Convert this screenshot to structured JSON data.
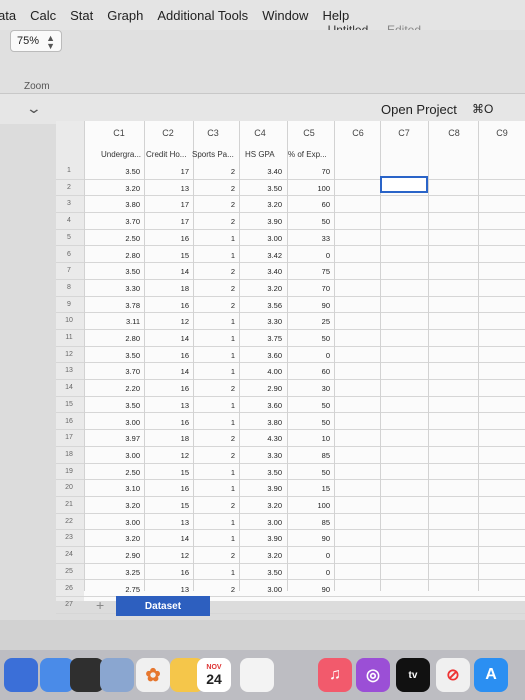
{
  "menubar": {
    "items": [
      "ata",
      "Calc",
      "Stat",
      "Graph",
      "Additional Tools",
      "Window",
      "Help"
    ]
  },
  "document": {
    "title": "Untitled",
    "sep": "—",
    "status": "Edited"
  },
  "zoom": {
    "value": "75%",
    "label": "Zoom"
  },
  "open_project": {
    "label": "Open Project",
    "shortcut": "⌘O"
  },
  "sheet": {
    "column_ids": [
      "C1",
      "C2",
      "C3",
      "C4",
      "C5",
      "C6",
      "C7",
      "C8",
      "C9"
    ],
    "variable_names": [
      "Undergra...",
      "Credit Ho...",
      "Sports Pa...",
      "HS GPA",
      "% of Exp..."
    ],
    "row_numbers": [
      "1",
      "2",
      "3",
      "4",
      "5",
      "6",
      "7",
      "8",
      "9",
      "10",
      "11",
      "12",
      "13",
      "14",
      "15",
      "16",
      "17",
      "18",
      "19",
      "20",
      "21",
      "22",
      "23",
      "24",
      "25",
      "26",
      "27"
    ],
    "rows": [
      [
        "3.50",
        "17",
        "2",
        "3.40",
        "70"
      ],
      [
        "3.20",
        "13",
        "2",
        "3.50",
        "100"
      ],
      [
        "3.80",
        "17",
        "2",
        "3.20",
        "60"
      ],
      [
        "3.70",
        "17",
        "2",
        "3.90",
        "50"
      ],
      [
        "2.50",
        "16",
        "1",
        "3.00",
        "33"
      ],
      [
        "2.80",
        "15",
        "1",
        "3.42",
        "0"
      ],
      [
        "3.50",
        "14",
        "2",
        "3.40",
        "75"
      ],
      [
        "3.30",
        "18",
        "2",
        "3.20",
        "70"
      ],
      [
        "3.78",
        "16",
        "2",
        "3.56",
        "90"
      ],
      [
        "3.11",
        "12",
        "1",
        "3.30",
        "25"
      ],
      [
        "2.80",
        "14",
        "1",
        "3.75",
        "50"
      ],
      [
        "3.50",
        "16",
        "1",
        "3.60",
        "0"
      ],
      [
        "3.70",
        "14",
        "1",
        "4.00",
        "60"
      ],
      [
        "2.20",
        "16",
        "2",
        "2.90",
        "30"
      ],
      [
        "3.50",
        "13",
        "1",
        "3.60",
        "50"
      ],
      [
        "3.00",
        "16",
        "1",
        "3.80",
        "50"
      ],
      [
        "3.97",
        "18",
        "2",
        "4.30",
        "10"
      ],
      [
        "3.00",
        "12",
        "2",
        "3.30",
        "85"
      ],
      [
        "2.50",
        "15",
        "1",
        "3.50",
        "50"
      ],
      [
        "3.10",
        "16",
        "1",
        "3.90",
        "15"
      ],
      [
        "3.20",
        "15",
        "2",
        "3.20",
        "100"
      ],
      [
        "3.00",
        "13",
        "1",
        "3.00",
        "85"
      ],
      [
        "3.20",
        "14",
        "1",
        "3.90",
        "90"
      ],
      [
        "2.90",
        "12",
        "2",
        "3.20",
        "0"
      ],
      [
        "3.25",
        "16",
        "1",
        "3.50",
        "0"
      ],
      [
        "2.75",
        "13",
        "2",
        "3.00",
        "90"
      ]
    ]
  },
  "tabs": {
    "add": "+",
    "dataset": "Dataset"
  },
  "dock": {
    "calendar_month": "NOV",
    "calendar_day": "24",
    "tv_label": "tv"
  }
}
